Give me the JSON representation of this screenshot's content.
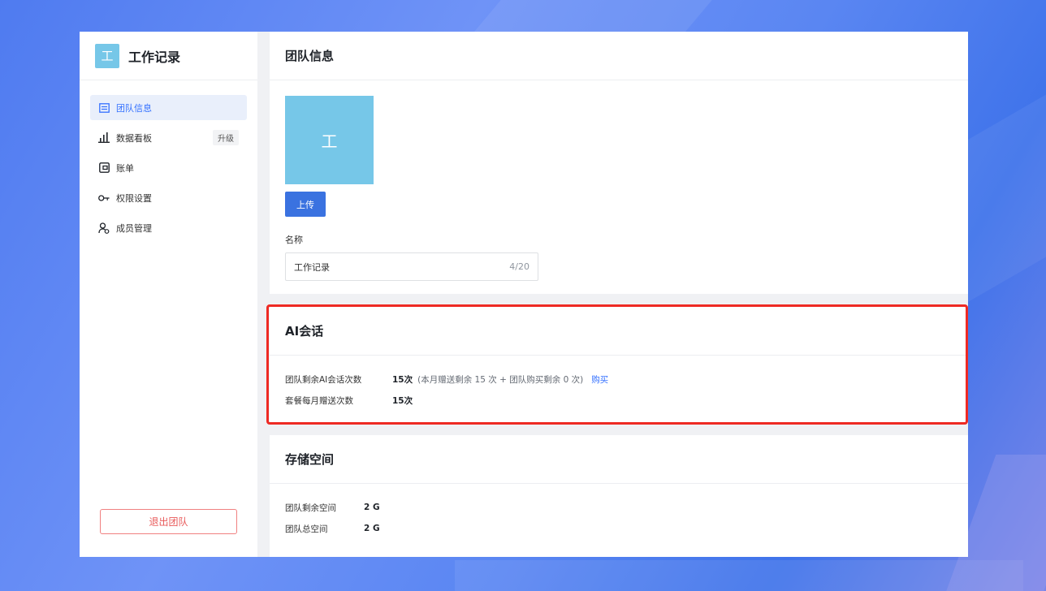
{
  "sidebar": {
    "brand_logo_char": "工",
    "brand_title": "工作记录",
    "items": [
      {
        "label": "团队信息",
        "icon": "team-info-icon",
        "active": true
      },
      {
        "label": "数据看板",
        "icon": "chart-icon",
        "badge": "升级"
      },
      {
        "label": "账单",
        "icon": "wallet-icon"
      },
      {
        "label": "权限设置",
        "icon": "key-icon"
      },
      {
        "label": "成员管理",
        "icon": "members-icon"
      }
    ],
    "quit_label": "退出团队"
  },
  "team_info": {
    "title": "团队信息",
    "avatar_char": "工",
    "upload_label": "上传",
    "name_label": "名称",
    "name_value": "工作记录",
    "name_count": "4/20"
  },
  "ai_chat": {
    "title": "AI会话",
    "rows": [
      {
        "label": "团队剩余AI会话次数",
        "value": "15次",
        "note": "(本月赠送剩余 15 次 + 团队购买剩余 0 次)",
        "link": "购买"
      },
      {
        "label": "套餐每月赠送次数",
        "value": "15次"
      }
    ]
  },
  "storage": {
    "title": "存储空间",
    "rows": [
      {
        "label": "团队剩余空间",
        "value": "2 G"
      },
      {
        "label": "团队总空间",
        "value": "2 G"
      }
    ]
  },
  "colors": {
    "accent": "#3a72e0",
    "avatar": "#76c7e8",
    "highlight": "#ee2a24",
    "danger": "#e85a5a"
  }
}
